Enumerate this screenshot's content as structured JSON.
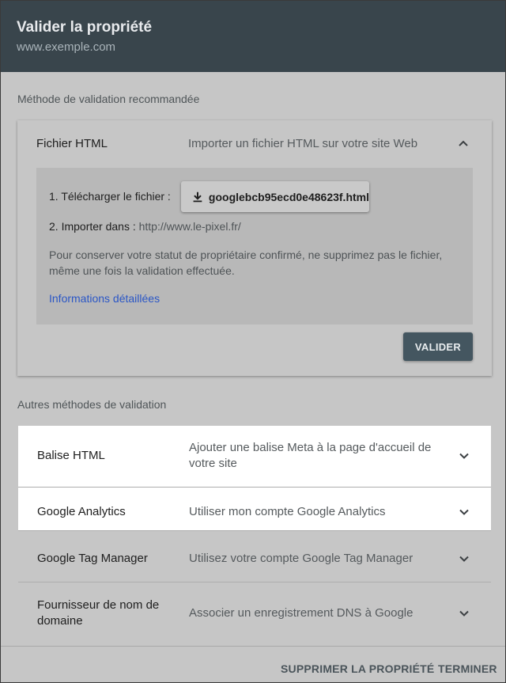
{
  "header": {
    "title": "Valider la propriété",
    "subtitle": "www.exemple.com"
  },
  "recommended": {
    "section_label": "Méthode de validation recommandée",
    "title": "Fichier HTML",
    "description": "Importer un fichier HTML sur votre site Web",
    "step1_label": "1. Télécharger le fichier :",
    "download_file": "googlebcb95ecd0e48623f.html",
    "step2_label": "2. Importer dans :",
    "step2_url": "http://www.le-pixel.fr/",
    "note": "Pour conserver votre statut de propriétaire confirmé, ne supprimez pas le fichier, même une fois la validation effectuée.",
    "info_link": "Informations détaillées",
    "validate_button": "VALIDER"
  },
  "other": {
    "section_label": "Autres méthodes de validation",
    "methods": [
      {
        "title": "Balise HTML",
        "description": "Ajouter une balise Meta à la page d'accueil de votre site"
      },
      {
        "title": "Google Analytics",
        "description": "Utiliser mon compte Google Analytics"
      },
      {
        "title": "Google Tag Manager",
        "description": "Utilisez votre compte Google Tag Manager"
      },
      {
        "title": "Fournisseur de nom de domaine",
        "description": "Associer un enregistrement DNS à Google"
      }
    ]
  },
  "footer": {
    "delete_button": "SUPPRIMER LA PROPRIÉTÉ",
    "finish_button": "TERMINER"
  },
  "icons": {
    "download": "download-icon",
    "expand": "chevron-down-icon",
    "collapse": "chevron-up-icon"
  },
  "colors": {
    "header_bg": "#39454c",
    "accent_button": "#445660",
    "link": "#2a56c6"
  }
}
